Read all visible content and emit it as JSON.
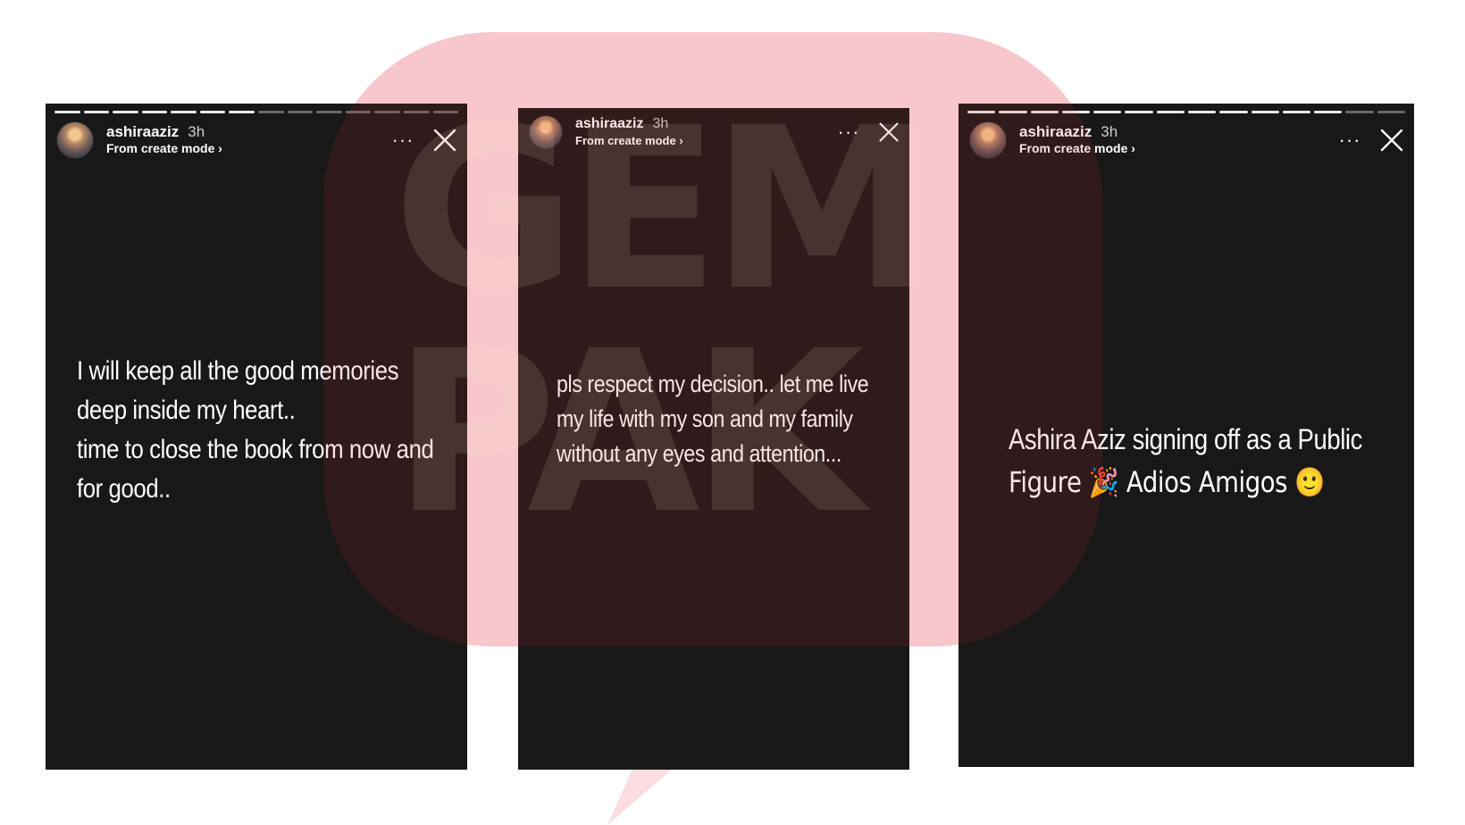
{
  "watermark": {
    "line1": "GEM",
    "line2": "PAK"
  },
  "stories": [
    {
      "username": "ashiraaziz",
      "time": "3h",
      "mode": "From create mode ›",
      "more": "···",
      "text_lines": [
        "I will keep all the good memories",
        "deep inside my heart..",
        "time to close the book from now and",
        "for good.."
      ]
    },
    {
      "username": "ashiraaziz",
      "time": "3h",
      "mode": "From create mode ›",
      "more": "···",
      "text_lines": [
        "pls respect my decision.. let me live",
        "my life with my son and my family",
        "without any eyes and attention..."
      ]
    },
    {
      "username": "ashiraaziz",
      "time": "3h",
      "mode": "From create mode ›",
      "more": "···",
      "text_lines": [
        "Ashira Aziz signing off as a Public",
        "Figure 🎉 Adios Amigos 🙂"
      ]
    }
  ],
  "icons": {
    "close": "close-icon",
    "more": "more-options-icon",
    "avatar": "profile-avatar"
  },
  "colors": {
    "story_bg": "#181818",
    "watermark_pink": "#fbdde1",
    "text": "#ffffff"
  }
}
